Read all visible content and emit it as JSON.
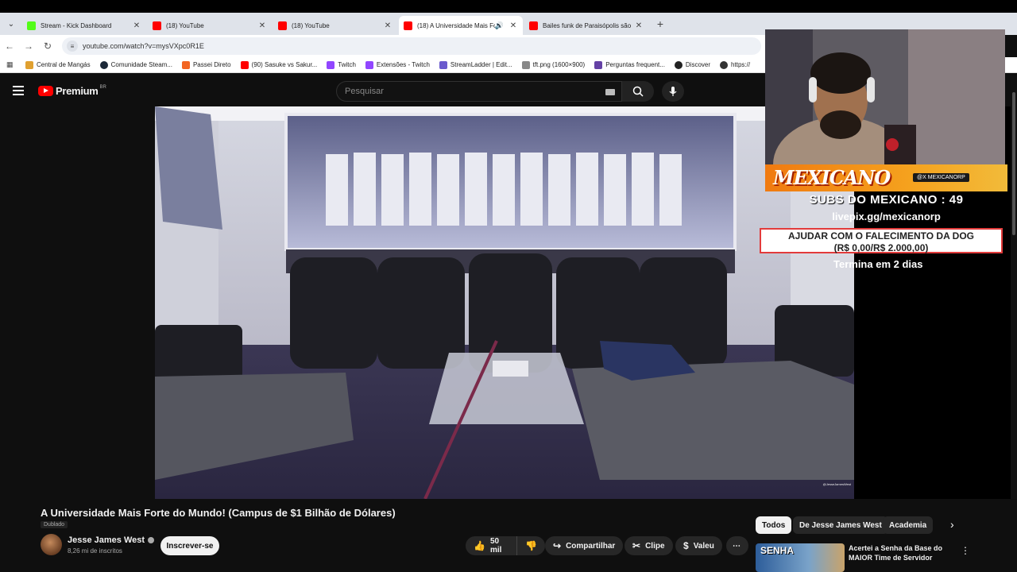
{
  "browser": {
    "tabs": [
      {
        "title": "Stream - Kick Dashboard",
        "color": "#53fc18",
        "active": false
      },
      {
        "title": "(18) YouTube",
        "color": "#ff0000",
        "active": false
      },
      {
        "title": "(18) YouTube",
        "color": "#ff0000",
        "active": false
      },
      {
        "title": "(18) A Universidade Mais Fo",
        "color": "#ff0000",
        "active": true
      },
      {
        "title": "Bailes funk de Paraisópolis são",
        "color": "#ff0000",
        "active": false
      }
    ],
    "url": "youtube.com/watch?v=mysVXpc0R1E",
    "bookmarks": [
      {
        "label": "Central de Mangás",
        "color": "#e0a030"
      },
      {
        "label": "Comunidade Steam...",
        "color": "#1b2838"
      },
      {
        "label": "Passei Direto",
        "color": "#f26522"
      },
      {
        "label": "(90) Sasuke vs Sakur...",
        "color": "#ff0000"
      },
      {
        "label": "Twitch",
        "color": "#9146ff"
      },
      {
        "label": "Extensões - Twitch",
        "color": "#9146ff"
      },
      {
        "label": "StreamLadder | Edit...",
        "color": "#6a5acd"
      },
      {
        "label": "tft.png (1600×900)",
        "color": "#888888"
      },
      {
        "label": "Perguntas frequent...",
        "color": "#6441a5"
      },
      {
        "label": "Discover",
        "color": "#222222"
      },
      {
        "label": "https://",
        "color": "#333333"
      }
    ]
  },
  "youtube": {
    "brand": "Premium",
    "country": "BR",
    "search_placeholder": "Pesquisar",
    "video_title": "A Universidade Mais Forte do Mundo! (Campus de $1 Bilhão de Dólares)",
    "dubbed_label": "Dublado",
    "channel": "Jesse James West",
    "subscribers": "8,26 mi de inscritos",
    "subscribe_label": "Inscrever-se",
    "likes": "50 mil",
    "share_label": "Compartilhar",
    "clip_label": "Clipe",
    "thanks_label": "Valeu",
    "chips": [
      "Todos",
      "De Jesse James West",
      "Academia"
    ],
    "rec_thumb_text": "SENHA",
    "rec_title": "Acertei a Senha da Base do MAIOR Time de Servidor"
  },
  "overlay": {
    "logo": "MEXICANO",
    "handle": "@X MEXICANORP",
    "subs": "SUBS DO MEXICANO : 49",
    "livepix": "livepix.gg/mexicanorp",
    "goal_title": "AJUDAR COM O FALECIMENTO DA DOG",
    "goal_value": "(R$ 0,00/R$ 2.000,00)",
    "ends": "Termina em 2 dias"
  }
}
